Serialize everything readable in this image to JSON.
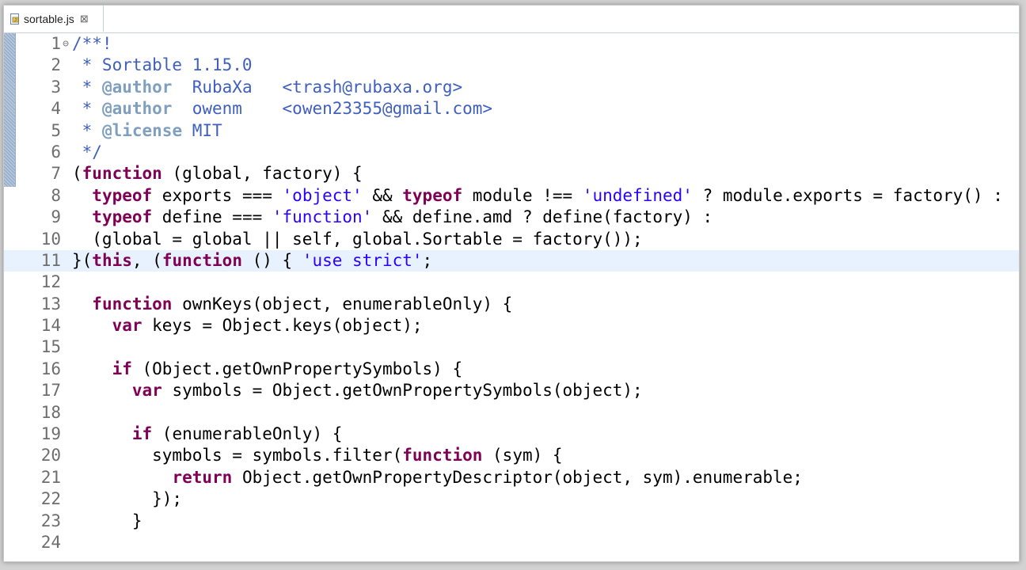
{
  "tab": {
    "filename": "sortable.js",
    "close_glyph": "⊠"
  },
  "colors": {
    "keyword": "#7f0055",
    "string": "#2a00ff",
    "comment": "#3f5fbf",
    "javadoc_tag": "#7f9fbf",
    "current_line": "#e8f2fe"
  },
  "editor": {
    "fold_marker": "⊖",
    "current_line": 11,
    "lines": [
      {
        "n": "1",
        "tokens": [
          [
            "c",
            "/**!"
          ]
        ]
      },
      {
        "n": "2",
        "tokens": [
          [
            "c",
            " * Sortable 1.15.0"
          ]
        ]
      },
      {
        "n": "3",
        "tokens": [
          [
            "c",
            " * "
          ],
          [
            "t",
            "@author"
          ],
          [
            "c",
            "  RubaXa   <trash@rubaxa.org>"
          ]
        ]
      },
      {
        "n": "4",
        "tokens": [
          [
            "c",
            " * "
          ],
          [
            "t",
            "@author"
          ],
          [
            "c",
            "  owenm    <owen23355@gmail.com>"
          ]
        ]
      },
      {
        "n": "5",
        "tokens": [
          [
            "c",
            " * "
          ],
          [
            "t",
            "@license"
          ],
          [
            "c",
            " MIT"
          ]
        ]
      },
      {
        "n": "6",
        "tokens": [
          [
            "c",
            " */"
          ]
        ]
      },
      {
        "n": "7",
        "tokens": [
          [
            "p",
            "("
          ],
          [
            "k",
            "function"
          ],
          [
            "p",
            " (global, factory) {"
          ]
        ]
      },
      {
        "n": "8",
        "tokens": [
          [
            "p",
            "  "
          ],
          [
            "k",
            "typeof"
          ],
          [
            "p",
            " exports === "
          ],
          [
            "s",
            "'object'"
          ],
          [
            "p",
            " && "
          ],
          [
            "k",
            "typeof"
          ],
          [
            "p",
            " module !== "
          ],
          [
            "s",
            "'undefined'"
          ],
          [
            "p",
            " ? module.exports = factory() :"
          ]
        ]
      },
      {
        "n": "9",
        "tokens": [
          [
            "p",
            "  "
          ],
          [
            "k",
            "typeof"
          ],
          [
            "p",
            " define === "
          ],
          [
            "s",
            "'function'"
          ],
          [
            "p",
            " && define.amd ? define(factory) :"
          ]
        ]
      },
      {
        "n": "10",
        "tokens": [
          [
            "p",
            "  (global = global || self, global.Sortable = factory());"
          ]
        ]
      },
      {
        "n": "11",
        "tokens": [
          [
            "p",
            "}("
          ],
          [
            "k",
            "this"
          ],
          [
            "p",
            ", ("
          ],
          [
            "k",
            "function"
          ],
          [
            "p",
            " () { "
          ],
          [
            "s",
            "'use strict'"
          ],
          [
            "p",
            ";"
          ]
        ]
      },
      {
        "n": "12",
        "tokens": []
      },
      {
        "n": "13",
        "tokens": [
          [
            "p",
            "  "
          ],
          [
            "k",
            "function"
          ],
          [
            "p",
            " ownKeys(object, enumerableOnly) {"
          ]
        ]
      },
      {
        "n": "14",
        "tokens": [
          [
            "p",
            "    "
          ],
          [
            "k",
            "var"
          ],
          [
            "p",
            " keys = Object.keys(object);"
          ]
        ]
      },
      {
        "n": "15",
        "tokens": []
      },
      {
        "n": "16",
        "tokens": [
          [
            "p",
            "    "
          ],
          [
            "k",
            "if"
          ],
          [
            "p",
            " (Object.getOwnPropertySymbols) {"
          ]
        ]
      },
      {
        "n": "17",
        "tokens": [
          [
            "p",
            "      "
          ],
          [
            "k",
            "var"
          ],
          [
            "p",
            " symbols = Object.getOwnPropertySymbols(object);"
          ]
        ]
      },
      {
        "n": "18",
        "tokens": []
      },
      {
        "n": "19",
        "tokens": [
          [
            "p",
            "      "
          ],
          [
            "k",
            "if"
          ],
          [
            "p",
            " (enumerableOnly) {"
          ]
        ]
      },
      {
        "n": "20",
        "tokens": [
          [
            "p",
            "        symbols = symbols.filter("
          ],
          [
            "k",
            "function"
          ],
          [
            "p",
            " (sym) {"
          ]
        ]
      },
      {
        "n": "21",
        "tokens": [
          [
            "p",
            "          "
          ],
          [
            "k",
            "return"
          ],
          [
            "p",
            " Object.getOwnPropertyDescriptor(object, sym).enumerable;"
          ]
        ]
      },
      {
        "n": "22",
        "tokens": [
          [
            "p",
            "        });"
          ]
        ]
      },
      {
        "n": "23",
        "tokens": [
          [
            "p",
            "      }"
          ]
        ]
      },
      {
        "n": "24",
        "tokens": []
      }
    ]
  }
}
